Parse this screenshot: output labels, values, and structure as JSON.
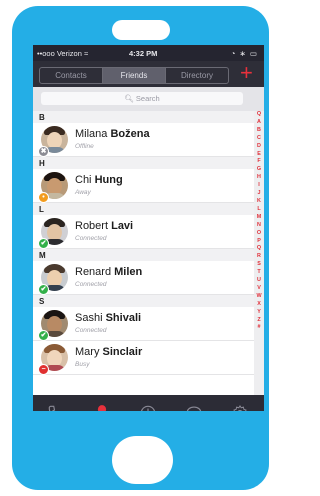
{
  "statusbar": {
    "carrier": "••ooo Verizon ≈",
    "time": "4:32 PM",
    "indicators": "◔ ∗ ▭"
  },
  "tabs": [
    {
      "label": "Contacts",
      "active": false
    },
    {
      "label": "Friends",
      "active": true
    },
    {
      "label": "Directory",
      "active": false
    }
  ],
  "add_label": "+",
  "search": {
    "placeholder": "Search",
    "icon": "search-icon"
  },
  "sections": [
    {
      "letter": "B",
      "contacts": [
        {
          "first": "Milana",
          "last": "Božena",
          "status": "Offline",
          "presence": "offline"
        }
      ]
    },
    {
      "letter": "H",
      "contacts": [
        {
          "first": "Chi",
          "last": "Hung",
          "status": "Away",
          "presence": "away"
        }
      ]
    },
    {
      "letter": "L",
      "contacts": [
        {
          "first": "Robert",
          "last": "Lavi",
          "status": "Connected",
          "presence": "connected"
        }
      ]
    },
    {
      "letter": "M",
      "contacts": [
        {
          "first": "Renard",
          "last": "Milen",
          "status": "Connected",
          "presence": "connected"
        }
      ]
    },
    {
      "letter": "S",
      "contacts": [
        {
          "first": "Sashi",
          "last": "Shivali",
          "status": "Connected",
          "presence": "connected"
        },
        {
          "first": "Mary",
          "last": "Sinclair",
          "status": "Busy",
          "presence": "busy"
        }
      ]
    }
  ],
  "index_letters": [
    "Q",
    "A",
    "B",
    "C",
    "D",
    "E",
    "F",
    "G",
    "H",
    "I",
    "J",
    "K",
    "L",
    "M",
    "N",
    "O",
    "P",
    "Q",
    "R",
    "S",
    "T",
    "U",
    "V",
    "W",
    "X",
    "Y",
    "Z",
    "#"
  ],
  "bottom_tabs": [
    {
      "name": "phone-icon",
      "active": false
    },
    {
      "name": "contacts-icon",
      "active": true
    },
    {
      "name": "recents-clock-icon",
      "active": false
    },
    {
      "name": "chat-bubble-icon",
      "active": false
    },
    {
      "name": "settings-gear-icon",
      "active": false
    }
  ],
  "colors": {
    "phone_frame": "#24aee6",
    "accent": "#e8313c",
    "dark_bar": "#2c2c36"
  }
}
